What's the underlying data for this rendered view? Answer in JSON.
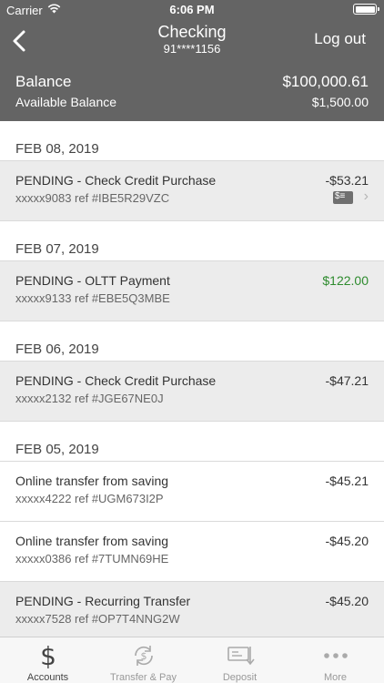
{
  "status": {
    "carrier": "Carrier",
    "time": "6:06 PM"
  },
  "nav": {
    "title": "Checking",
    "account_number": "91****1156",
    "logout_label": "Log out"
  },
  "balance": {
    "label": "Balance",
    "value": "$100,000.61",
    "available_label": "Available Balance",
    "available_value": "$1,500.00"
  },
  "groups": [
    {
      "date": "FEB 08, 2019",
      "transactions": [
        {
          "title": "PENDING - Check Credit Purchase",
          "ref": "xxxxx9083 ref #IBE5R29VZC",
          "amount": "-$53.21"
        }
      ]
    },
    {
      "date": "FEB 07, 2019",
      "transactions": [
        {
          "title": "PENDING - OLTT Payment",
          "ref": "xxxxx9133 ref #EBE5Q3MBE",
          "amount": "$122.00"
        }
      ]
    },
    {
      "date": "FEB 06, 2019",
      "transactions": [
        {
          "title": "PENDING - Check Credit Purchase",
          "ref": "xxxxx2132 ref #JGE67NE0J",
          "amount": "-$47.21"
        }
      ]
    },
    {
      "date": "FEB 05, 2019",
      "transactions": [
        {
          "title": "Online transfer from saving",
          "ref": "xxxxx4222 ref #UGM673I2P",
          "amount": "-$45.21"
        },
        {
          "title": "Online transfer from saving",
          "ref": "xxxxx0386 ref #7TUMN69HE",
          "amount": "-$45.20"
        },
        {
          "title": "PENDING - Recurring Transfer",
          "ref": "xxxxx7528 ref #OP7T4NNG2W",
          "amount": "-$45.20"
        }
      ]
    }
  ],
  "tabs": [
    {
      "label": "Accounts",
      "icon": "dollar-icon"
    },
    {
      "label": "Transfer & Pay",
      "icon": "transfer-icon"
    },
    {
      "label": "Deposit",
      "icon": "check-deposit-icon"
    },
    {
      "label": "More",
      "icon": "more-dots-icon"
    }
  ],
  "colors": {
    "header": "#646464",
    "pending_row": "#ececec",
    "credit_amount": "#2e8b2e"
  }
}
